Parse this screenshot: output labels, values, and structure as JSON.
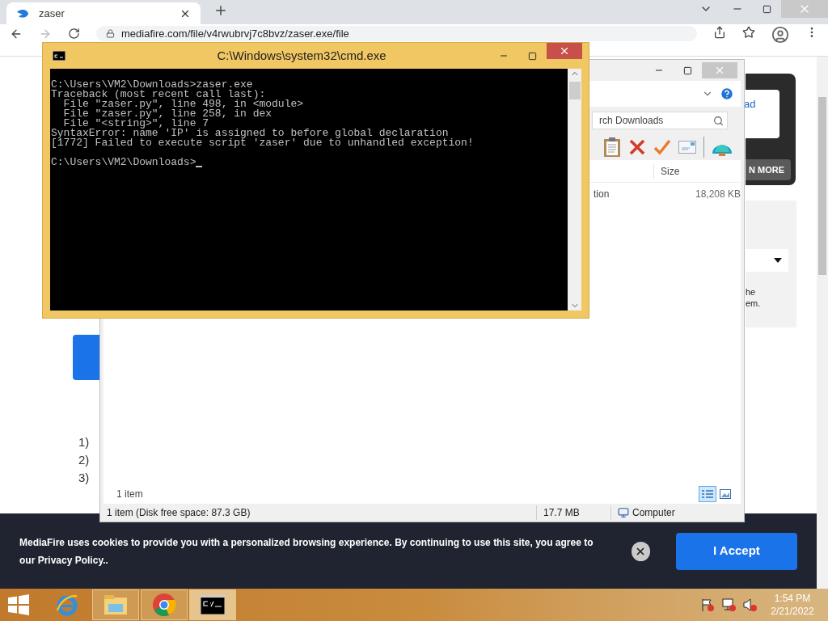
{
  "browser": {
    "tab": {
      "title": "zaser"
    },
    "url": "mediafire.com/file/v4rwubrvj7c8bvz/zaser.exe/file"
  },
  "page": {
    "side_card": {
      "link": "ad",
      "button": "N MORE"
    },
    "side_panel": {
      "text_lines": [
        "he",
        "em."
      ]
    },
    "steps": [
      "1)",
      "2)",
      "3)"
    ],
    "cookie_banner": {
      "text": "MediaFire uses cookies to provide you with a personalized browsing experience. By continuing to use this site, you agree to our Privacy Policy..",
      "accept": "I Accept"
    }
  },
  "explorer": {
    "search": "rch Downloads",
    "columns": [
      "Size"
    ],
    "rows": [
      {
        "name": "tion",
        "size": "18,208 KB"
      }
    ],
    "item_count": "1 item",
    "views": [
      {
        "kind": "details",
        "selected": true
      },
      {
        "kind": "preview",
        "selected": false
      }
    ],
    "status": [
      "1 item (Disk free space: 87.3 GB)",
      "17.7 MB",
      "Computer"
    ]
  },
  "cmd": {
    "title": "C:\\Windows\\system32\\cmd.exe",
    "lines": [
      "C:\\Users\\VM2\\Downloads>zaser.exe",
      "Traceback (most recent call last):",
      "  File \"zaser.py\", line 498, in <module>",
      "  File \"zaser.py\", line 258, in dex",
      "  File \"<string>\", line 7",
      "SyntaxError: name 'IP' is assigned to before global declaration",
      "[1772] Failed to execute script 'zaser' due to unhandled exception!"
    ],
    "prompt": "C:\\Users\\VM2\\Downloads>",
    "cursor": true
  },
  "taskbar": {
    "apps": [
      {
        "kind": "ie",
        "running": false,
        "selected": false
      },
      {
        "kind": "explorer",
        "running": true,
        "selected": false
      },
      {
        "kind": "chrome",
        "running": true,
        "selected": false
      },
      {
        "kind": "cmd",
        "running": true,
        "selected": true
      }
    ],
    "time": "1:54 PM",
    "date": "2/21/2022"
  }
}
